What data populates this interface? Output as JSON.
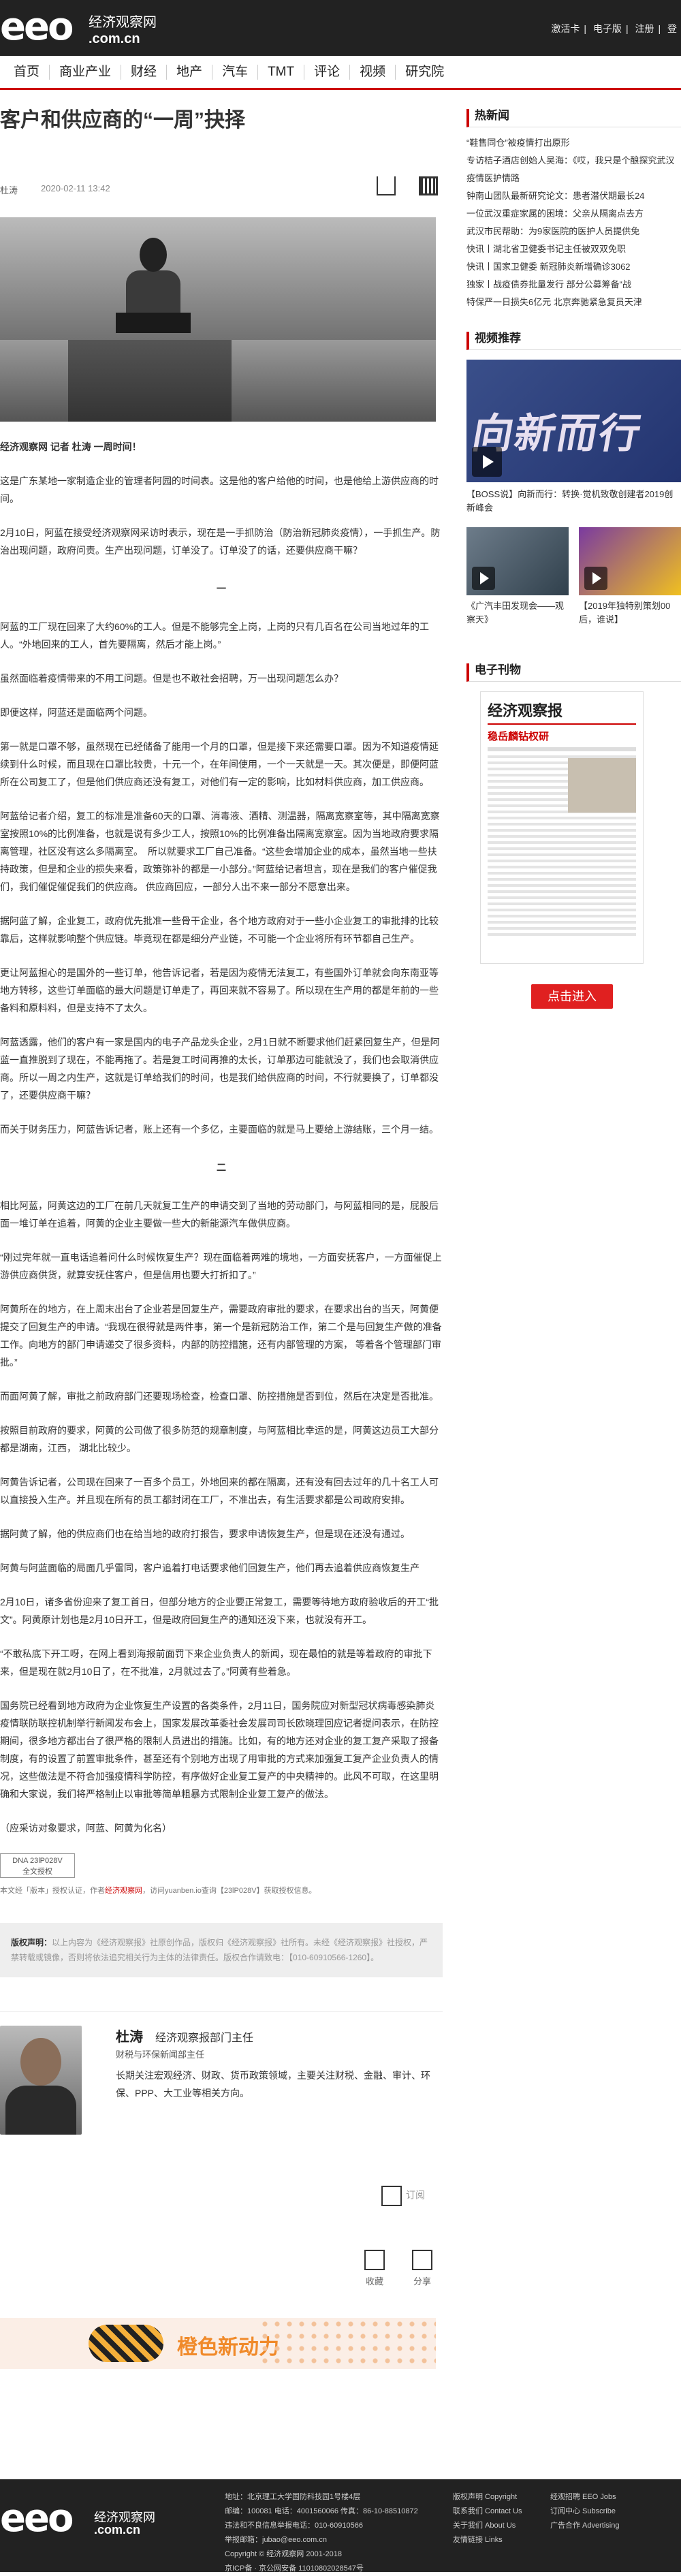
{
  "header": {
    "logo": "eeo",
    "logo_cn": "经济观察网",
    "logo_domain": ".com.cn",
    "links": [
      "激活卡",
      "电子版",
      "注册",
      "登"
    ]
  },
  "nav": [
    "首页",
    "商业产业",
    "财经",
    "地产",
    "汽车",
    "TMT",
    "评论",
    "视频",
    "研究院"
  ],
  "article": {
    "title": "客户和供应商的“一周”抉择",
    "author": "杜涛",
    "date": "2020-02-11 13:42",
    "lead": "经济观察网 记者 杜涛  一周时间！",
    "paragraphs": [
      "这是广东某地一家制造企业的管理者阿园的时间表。这是他的客户给他的时间，也是他给上游供应商的时间。",
      "2月10日，阿蓝在接受经济观察网采访时表示，现在是一手抓防治（防治新冠肺炎疫情），一手抓生产。防治出现问题，政府问责。生产出现问题，订单没了。订单没了的话，还要供应商干嘛？",
      "阿蓝的工厂现在回来了大约60%的工人。但是不能够完全上岗，上岗的只有几百名在公司当地过年的工人。“外地回来的工人，首先要隔离，然后才能上岗。”",
      "虽然面临着疫情带来的不用工问题。但是也不敢社会招聘，万一出现问题怎么办？",
      "即便这样，阿蓝还是面临两个问题。",
      "第一就是口罩不够，虽然现在已经储备了能用一个月的口罩，但是接下来还需要口罩。因为不知道疫情延续到什么时候，而且现在口罩比较贵，十元一个，在年间使用，一个一天就是一天。其次便是，即便阿蓝所在公司复工了，但是他们供应商还没有复工，对他们有一定的影响，比如材料供应商，加工供应商。",
      "阿蓝给记者介绍，复工的标准是准备60天的口罩、消毒液、酒精、测温器，隔离宽察室等，其中隔离宽察室按照10%的比例准备，也就是说有多少工人，按照10%的比例准备出隔离宽察室。因为当地政府要求隔离管理，社区没有这么多隔离室。　所以就要求工厂自己准备。“这些会增加企业的成本，虽然当地一些扶持政策，但是和企业的损失来看，政策弥补的都是一小部分。”阿蓝给记者坦言，现在是我们的客户催促我们，我们催促催促我们的供应商。  供应商回应，一部分人出不来一部分不愿意出来。",
      "据阿蓝了解，企业复工，政府优先批准一些骨干企业，各个地方政府对于一些小企业复工的审批排的比较靠后，这样就影响整个供应链。毕竟现在都是细分产业链，不可能一个企业将所有环节都自己生产。",
      "更让阿蓝担心的是国外的一些订单，他告诉记者，若是因为疫情无法复工，有些国外订单就会向东南亚等地方转移，这些订单面临的最大问题是订单走了，再回来就不容易了。所以现在生产用的都是年前的一些备料和原料料，但是支持不了太久。",
      "阿蓝透露，他们的客户有一家是国内的电子产品龙头企业，2月1日就不断要求他们赶紧回复生产，但是阿蓝一直推脱到了现在，不能再拖了。若是复工时间再推的太长，订单那边可能就没了，我们也会取消供应商。所以一周之内生产，这就是订单给我们的时间，也是我们给供应商的时间，不行就要换了，订单都没了，还要供应商干嘛？",
      "而关于财务压力，阿蓝告诉记者，账上还有一个多亿，主要面临的就是马上要给上游结账，三个月一结。",
      "相比阿蓝，阿黄这边的工厂在前几天就复工生产的申请交到了当地的劳动部门，与阿蓝相同的是，屁股后面一堆订单在追着，阿黄的企业主要做一些大的新能源汽车做供应商。",
      "“刚过完年就一直电话追着问什么时候恢复生产？现在面临着两难的境地，一方面安抚客户，一方面催促上游供应商供货，就算安抚住客户，但是信用也要大打折扣了。”",
      "阿黄所在的地方，在上周末出台了企业若是回复生产，需要政府审批的要求，在要求出台的当天，阿黄便提交了回复生产的申请。“我现在很得就是两件事，第一个是新冠防治工作，第二个是与回复生产做的准备工作。向地方的部门申请递交了很多资料，内部的防控措施，还有内部管理的方案，  等着各个管理部门审批。”",
      "而面阿黄了解，审批之前政府部门还要现场检查，检查口罩、防控措施是否到位，然后在决定是否批准。",
      "按照目前政府的要求，阿黄的公司做了很多防范的规章制度，与阿蓝相比幸运的是，阿黄这边员工大部分都是湖南，江西，  湖北比较少。",
      "阿黄告诉记者，公司现在回来了一百多个员工，外地回来的都在隔离，还有没有回去过年的几十名工人可以直接投入生产。并且现在所有的员工都封闭在工厂，不准出去，有生活要求都是公司政府安排。",
      "据阿黄了解，他的供应商们也在给当地的政府打报告，要求申请恢复生产，但是现在还没有通过。",
      "阿黄与阿蓝面临的局面几乎雷同，客户追着打电话要求他们回复生产，他们再去追着供应商恢复生产",
      "2月10日，诸多省份迎来了复工首日，但部分地方的企业要正常复工，需要等待地方政府验收后的开工“批文”。阿黄原计划也是2月10日开工，但是政府回复生产的通知还没下来，也就没有开工。",
      "“不敢私底下开工呀，在网上看到海报前面罚下来企业负责人的新闻，现在最怕的就是等着政府的审批下来，但是现在就2月10日了，在不批准，2月就过去了。”阿黄有些着急。",
      "国务院已经看到地方政府为企业恢复生产设置的各类条件，2月11日，国务院应对新型冠状病毒感染肺炎疫情联防联控机制举行新闻发布会上，国家发展改革委社会发展司司长欧晓理回应记者提问表示，在防控期间，很多地方都出台了很严格的限制人员进出的措施。比如，有的地方还对企业的复工复产采取了报备制度，有的设置了前置审批条件，甚至还有个别地方出现了用审批的方式来加强复工复产企业负责人的情况，这些做法是不符合加强疫情科学防控，有序做好企业复工复产的中央精神的。此风不可取，在这里明确和大家说，我们将严格制止以审批等简单粗暴方式限制企业复工复产的做法。",
      "（应采访对象要求，阿蓝、阿黄为化名）"
    ],
    "sections": [
      "一",
      "二"
    ],
    "tag_lines": [
      "DNA 23lP028V",
      "全文授权"
    ],
    "source_note": "本文经「版本」授权认证，作者",
    "source_highlight": "经济观察网",
    "source_tail": "，访问yuanben.io查询【23lP028V】获取授权信息。",
    "rights_label": "版权声明：",
    "rights_text": "以上内容为《经济观察报》社原创作品，版权归《经济观察报》社所有。未经《经济观察报》社授权，严禁转载或镜像，否则将依法追究相关行为主体的法律责任。版权合作请致电：【010-60910566-1260】。"
  },
  "author_box": {
    "name": "杜涛",
    "role": "经济观察报部门主任",
    "dept": "财税与环保新闻部主任",
    "desc": "长期关注宏观经济、财政、货币政策领域，主要关注财税、金融、审计、环保、PPP、大工业等相关方向。",
    "subscribe": "订阅"
  },
  "actions": [
    "收藏",
    "分享"
  ],
  "ad": {
    "text": "橙色新动力"
  },
  "sidebar": {
    "hot_title": "热新闻",
    "hot_items": [
      "“鞋售同仓”被疫情打出原形",
      "专访桔子酒店创始人吴海：《哎，我只是个酿探究武汉疫情医护情路",
      "钟南山团队最新研究论文：患者潜伏期最长24",
      "一位武汉重症家属的困境：父亲从隔离点去方",
      "武汉市民帮助：为9家医院的医护人员提供免",
      "快讯丨湖北省卫健委书记主任被双双免职",
      "快讯丨国家卫健委 新冠肺炎新增确诊3062",
      "独家丨战疫债券批量发行 部分公募筹备“战",
      "特保严一日损失6亿元 北京奔驰紧急复员天津"
    ],
    "video_title": "视频推荐",
    "video_main_overlay": "向新而行",
    "video_main_cap": "【BOSS说】向新而行：转换·觉机致敬创建者2019创新峰会",
    "video_small": [
      {
        "cap": "《广汽丰田发现会——观察天》"
      },
      {
        "cap": "【2019年独特别策划00后，谁说】"
      }
    ],
    "epaper_title": "电子刊物",
    "epaper_mast": "经济观察报",
    "epaper_headline": "稳岳麟钻权研",
    "read_btn": "点击进入"
  },
  "footer": {
    "logo": "eeo",
    "logo_cn": "经济观察网",
    "logo_domain": ".com.cn",
    "address_lines": [
      "地址：北京理工大学国防科技园1号楼4层",
      "邮编：100081  电话：4001560066 传真：86-10-88510872",
      "违法和不良信息举报电话：010-60910566",
      "举报邮箱：jubao@eeo.com.cn",
      "Copyright ©  经济观察网  2001-2018",
      "京ICP备 · 京公网安备 11010802028547号"
    ],
    "links1": [
      "版权声明 Copyright",
      "联系我们 Contact Us",
      "关于我们 About Us",
      "友情链接 Links"
    ],
    "links2": [
      "经观招聘 EEO Jobs",
      "订阅中心 Subscribe",
      "广告合作 Advertising"
    ]
  }
}
